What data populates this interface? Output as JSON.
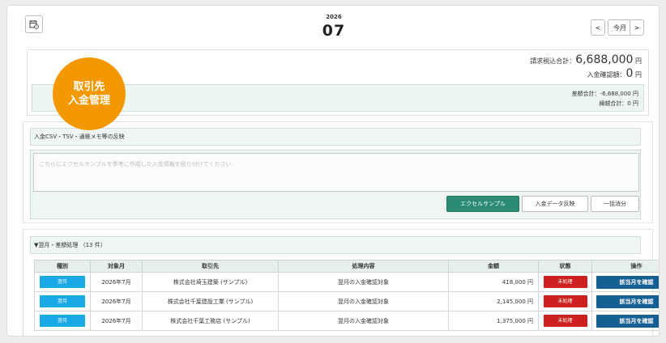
{
  "header": {
    "year": "2026",
    "month": "07",
    "prev_label": "<",
    "today_label": "今月",
    "next_label": ">"
  },
  "summary": {
    "billing_label": "請求税込合計：",
    "billing_value": "6,688,000",
    "billing_unit": "円",
    "confirmed_label": "入金確認額：",
    "confirmed_value": "0",
    "confirmed_unit": "円",
    "diff_line": "差額合計：-6,688,000 円",
    "carry_line": "繰越合計：0 円"
  },
  "badge": {
    "line1": "取引先",
    "line2": "入金管理"
  },
  "import_panel": {
    "title": "入金CSV・TSV・通帳メモ等の反映",
    "placeholder": "こちらにエクセルサンプルを参考に作成した入金情報を貼り付けてください",
    "excel_sample_label": "エクセルサンプル",
    "apply_label": "入金データ反映",
    "bulk_clear_label": "一括消分"
  },
  "list_panel": {
    "title": "▼翌月・差額処理 （13 件）",
    "columns": [
      "種別",
      "対象月",
      "取引先",
      "処理内容",
      "金額",
      "状態",
      "操作"
    ],
    "rows": [
      {
        "type": "翌月",
        "month": "2026年7月",
        "partner": "株式会社埼玉建築 (サンプル)",
        "content": "翌月の入金確認対象",
        "amount": "418,000 円",
        "status": "未処理",
        "action": "該当月を確認"
      },
      {
        "type": "翌月",
        "month": "2026年7月",
        "partner": "株式会社千葉建設工業 (サンプル)",
        "content": "翌月の入金確認対象",
        "amount": "2,145,000 円",
        "status": "未処理",
        "action": "該当月を確認"
      },
      {
        "type": "翌月",
        "month": "2026年7月",
        "partner": "株式会社千葉工務店 (サンプル)",
        "content": "翌月の入金確認対象",
        "amount": "1,375,000 円",
        "status": "未処理",
        "action": "該当月を確認"
      }
    ]
  },
  "colors": {
    "accent_green": "#2a8b74",
    "badge_orange": "#f39800",
    "type_blue": "#18a9e6",
    "status_red": "#cf2020",
    "action_navy": "#165f92"
  }
}
